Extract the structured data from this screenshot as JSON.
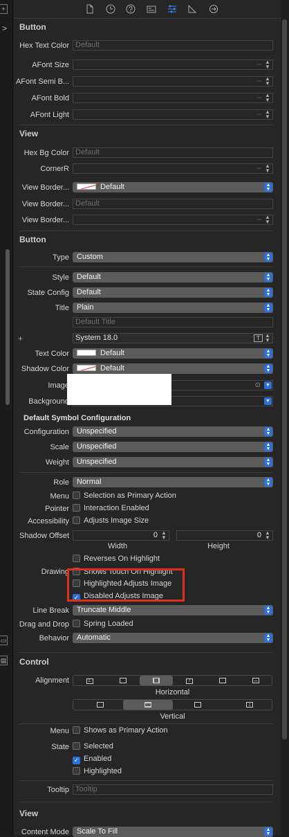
{
  "tabs": [
    "file-icon",
    "history-icon",
    "help-icon",
    "identity-icon",
    "attributes-icon",
    "size-icon",
    "connections-icon"
  ],
  "sections": {
    "button1": "Button",
    "view1": "View",
    "button2": "Button",
    "control": "Control",
    "view2": "View"
  },
  "button1": {
    "hex_text_color": {
      "label": "Hex Text Color",
      "placeholder": "Default"
    },
    "afont_size": {
      "label": "AFont Size",
      "stepper": "--"
    },
    "afont_semi": {
      "label": "AFont Semi B...",
      "stepper": "--"
    },
    "afont_bold": {
      "label": "AFont Bold",
      "stepper": "--"
    },
    "afont_light": {
      "label": "AFont Light",
      "stepper": "--"
    }
  },
  "view1": {
    "hex_bg_color": {
      "label": "Hex Bg Color",
      "placeholder": "Default"
    },
    "corner_r": {
      "label": "CornerR",
      "stepper": "--"
    },
    "view_border1": {
      "label": "View Border...",
      "value": "Default"
    },
    "view_border2": {
      "label": "View Border...",
      "placeholder": "Default"
    },
    "view_border3": {
      "label": "View Border...",
      "stepper": "--"
    }
  },
  "button2": {
    "type": {
      "label": "Type",
      "value": "Custom"
    },
    "style": {
      "label": "Style",
      "value": "Default"
    },
    "state_config": {
      "label": "State Config",
      "value": "Default"
    },
    "title": {
      "label": "Title",
      "value": "Plain"
    },
    "title_text": {
      "placeholder": "Default Title"
    },
    "font": {
      "plus": "+",
      "value": "System 18.0"
    },
    "text_color": {
      "label": "Text Color",
      "value": "Default"
    },
    "shadow_color": {
      "label": "Shadow Color",
      "value": "Default"
    },
    "image": {
      "label": "Image"
    },
    "background": {
      "label": "Background"
    },
    "symbol_header": "Default Symbol Configuration",
    "configuration": {
      "label": "Configuration",
      "value": "Unspecified"
    },
    "scale": {
      "label": "Scale",
      "value": "Unspecified"
    },
    "weight": {
      "label": "Weight",
      "value": "Unspecified"
    },
    "role": {
      "label": "Role",
      "value": "Normal"
    },
    "menu": {
      "label": "Menu",
      "option": "Selection as Primary Action"
    },
    "pointer": {
      "label": "Pointer",
      "option": "Interaction Enabled"
    },
    "accessibility": {
      "label": "Accessibility",
      "option": "Adjusts Image Size"
    },
    "shadow_offset": {
      "label": "Shadow Offset",
      "width": "0",
      "height": "0",
      "width_label": "Width",
      "height_label": "Height"
    },
    "reverses": "Reverses On Highlight",
    "drawing": {
      "label": "Drawing",
      "shows_touch": "Shows Touch On Highlight",
      "highlighted_adjusts": "Highlighted Adjusts Image",
      "disabled_adjusts": "Disabled Adjusts Image"
    },
    "line_break": {
      "label": "Line Break",
      "value": "Truncate Middle"
    },
    "drag_drop": {
      "label": "Drag and Drop",
      "option": "Spring Loaded"
    },
    "behavior": {
      "label": "Behavior",
      "value": "Automatic"
    }
  },
  "control": {
    "alignment": {
      "label": "Alignment",
      "horizontal": "Horizontal",
      "vertical": "Vertical",
      "h_glyphs": [
        "L",
        "",
        "",
        "T",
        "",
        ""
      ]
    },
    "menu": {
      "label": "Menu",
      "option": "Shows as Primary Action"
    },
    "state": {
      "label": "State",
      "selected": "Selected",
      "enabled": "Enabled",
      "highlighted": "Highlighted"
    },
    "tooltip": {
      "label": "Tooltip",
      "placeholder": "Tooltip"
    }
  },
  "view2": {
    "content_mode": {
      "label": "Content Mode",
      "value": "Scale To Fill"
    }
  },
  "colors": {
    "accent": "#2f6fd8",
    "highlight_box": "#e0301e",
    "panel": "#262626"
  }
}
